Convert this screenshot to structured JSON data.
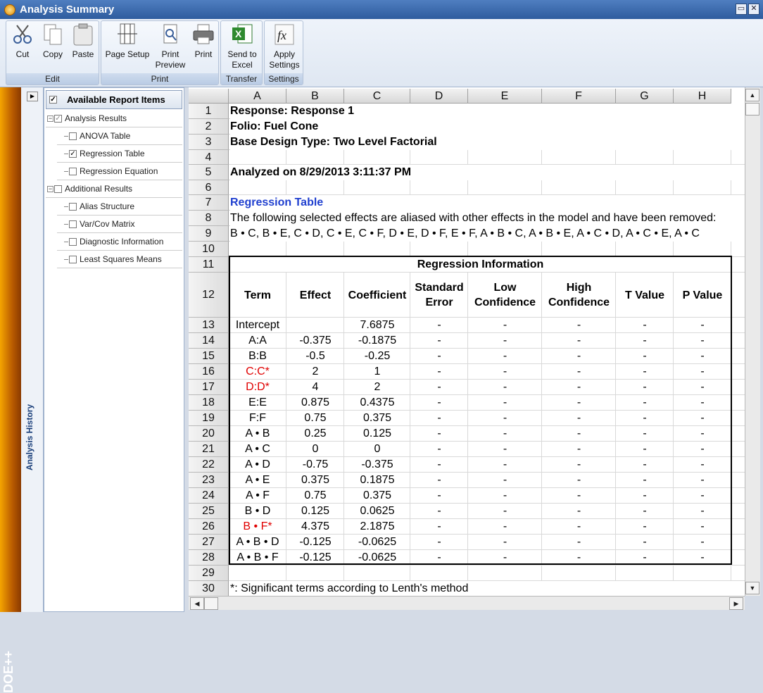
{
  "window": {
    "title": "Analysis Summary"
  },
  "ribbon": {
    "groups": [
      {
        "label": "Edit",
        "buttons": [
          "Cut",
          "Copy",
          "Paste"
        ]
      },
      {
        "label": "Print",
        "buttons": [
          "Page Setup",
          "Print Preview",
          "Print"
        ]
      },
      {
        "label": "Transfer",
        "buttons": [
          "Send to Excel"
        ]
      },
      {
        "label": "Settings",
        "buttons": [
          "Apply Settings"
        ]
      }
    ],
    "icons": [
      "scissors-icon",
      "copy-icon",
      "paste-icon",
      "page-setup-icon",
      "print-preview-icon",
      "printer-icon",
      "excel-icon",
      "fx-icon"
    ]
  },
  "side": {
    "history_label": "Analysis History",
    "logo": "DOE++"
  },
  "tree": {
    "header": "Available Report Items",
    "items": [
      {
        "label": "Analysis Results",
        "checked": true,
        "level": 0
      },
      {
        "label": "ANOVA Table",
        "checked": false,
        "level": 1
      },
      {
        "label": "Regression Table",
        "checked": true,
        "level": 1
      },
      {
        "label": "Regression Equation",
        "checked": false,
        "level": 1
      },
      {
        "label": "Additional Results",
        "checked": false,
        "level": 0
      },
      {
        "label": "Alias Structure",
        "checked": false,
        "level": 1
      },
      {
        "label": "Var/Cov Matrix",
        "checked": false,
        "level": 1
      },
      {
        "label": "Diagnostic Information",
        "checked": false,
        "level": 1
      },
      {
        "label": "Least Squares Means",
        "checked": false,
        "level": 1
      }
    ]
  },
  "sheet": {
    "columns": [
      "A",
      "B",
      "C",
      "D",
      "E",
      "F",
      "G",
      "H"
    ],
    "rows": [
      "1",
      "2",
      "3",
      "4",
      "5",
      "6",
      "7",
      "8",
      "9",
      "10",
      "11",
      "12",
      "13",
      "14",
      "15",
      "16",
      "17",
      "18",
      "19",
      "20",
      "21",
      "22",
      "23",
      "24",
      "25",
      "26",
      "27",
      "28",
      "29",
      "30"
    ],
    "response": "Response: Response 1",
    "folio": "Folio: Fuel Cone",
    "design": "Base Design Type: Two Level Factorial",
    "analyzed": "Analyzed on 8/29/2013 3:11:37 PM",
    "section_title": "Regression Table",
    "alias_note": "The following selected effects are aliased with other effects in the model and have been removed:",
    "alias_list": "B • C, B • E, C • D, C • E, C • F, D • E, D • F, E • F, A • B • C, A • B • E, A • C • D, A • C • E, A • C",
    "footnote": "*: Significant terms according to Lenth's method",
    "table_title": "Regression Information",
    "headers": [
      "Term",
      "Effect",
      "Coefficient",
      "Standard\nError",
      "Low\nConfidence",
      "High\nConfidence",
      "T Value",
      "P Value"
    ],
    "header_lines": [
      [
        "Term"
      ],
      [
        "Effect"
      ],
      [
        "Coefficient"
      ],
      [
        "Standard",
        "Error"
      ],
      [
        "Low",
        "Confidence"
      ],
      [
        "High",
        "Confidence"
      ],
      [
        "T Value"
      ],
      [
        "P Value"
      ]
    ],
    "data": [
      {
        "term": "Intercept",
        "effect": "",
        "coef": "7.6875",
        "sig": false
      },
      {
        "term": "A:A",
        "effect": "-0.375",
        "coef": "-0.1875",
        "sig": false
      },
      {
        "term": "B:B",
        "effect": "-0.5",
        "coef": "-0.25",
        "sig": false
      },
      {
        "term": "C:C*",
        "effect": "2",
        "coef": "1",
        "sig": true
      },
      {
        "term": "D:D*",
        "effect": "4",
        "coef": "2",
        "sig": true
      },
      {
        "term": "E:E",
        "effect": "0.875",
        "coef": "0.4375",
        "sig": false
      },
      {
        "term": "F:F",
        "effect": "0.75",
        "coef": "0.375",
        "sig": false
      },
      {
        "term": "A • B",
        "effect": "0.25",
        "coef": "0.125",
        "sig": false
      },
      {
        "term": "A • C",
        "effect": "0",
        "coef": "0",
        "sig": false
      },
      {
        "term": "A • D",
        "effect": "-0.75",
        "coef": "-0.375",
        "sig": false
      },
      {
        "term": "A • E",
        "effect": "0.375",
        "coef": "0.1875",
        "sig": false
      },
      {
        "term": "A • F",
        "effect": "0.75",
        "coef": "0.375",
        "sig": false
      },
      {
        "term": "B • D",
        "effect": "0.125",
        "coef": "0.0625",
        "sig": false
      },
      {
        "term": "B • F*",
        "effect": "4.375",
        "coef": "2.1875",
        "sig": true
      },
      {
        "term": "A • B • D",
        "effect": "-0.125",
        "coef": "-0.0625",
        "sig": false
      },
      {
        "term": "A • B • F",
        "effect": "-0.125",
        "coef": "-0.0625",
        "sig": false
      }
    ],
    "dash": "-"
  },
  "colors": {
    "significant": "#e00000",
    "section_title": "#1f3fcf",
    "title_bar": "#2e5c9e"
  }
}
